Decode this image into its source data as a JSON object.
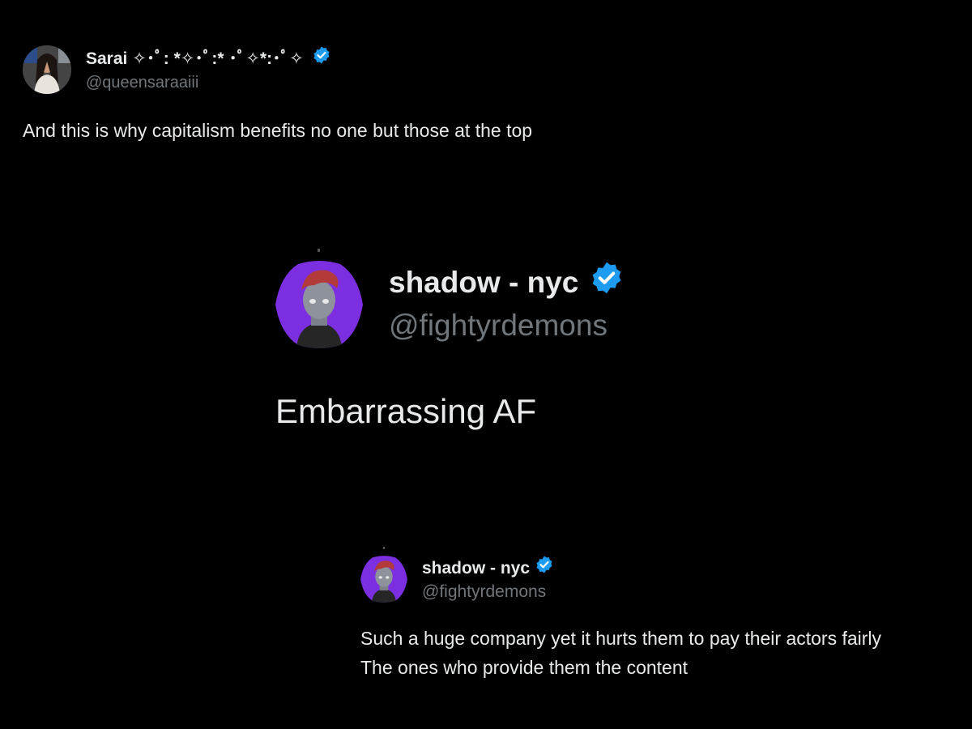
{
  "tweet1": {
    "display_name": "Sarai ✧･ﾟ: *✧･ﾟ:* ･ﾟ✧*:･ﾟ✧",
    "handle": "@queensaraaiii",
    "text": "And this is why capitalism benefits no one but those at the top",
    "verified_color": "#1d9bf0"
  },
  "tweet2": {
    "display_name": "shadow - nyc",
    "handle": "@fightyrdemons",
    "text": "Embarrassing AF",
    "verified_color": "#1d9bf0",
    "avatar_bg": "#7b2fe0"
  },
  "tweet3": {
    "display_name": "shadow - nyc",
    "handle": "@fightyrdemons",
    "text_line1": "Such a huge company yet it hurts them to pay their actors fairly",
    "text_line2": "The ones who provide them the content",
    "verified_color": "#1d9bf0",
    "avatar_bg": "#7b2fe0"
  }
}
